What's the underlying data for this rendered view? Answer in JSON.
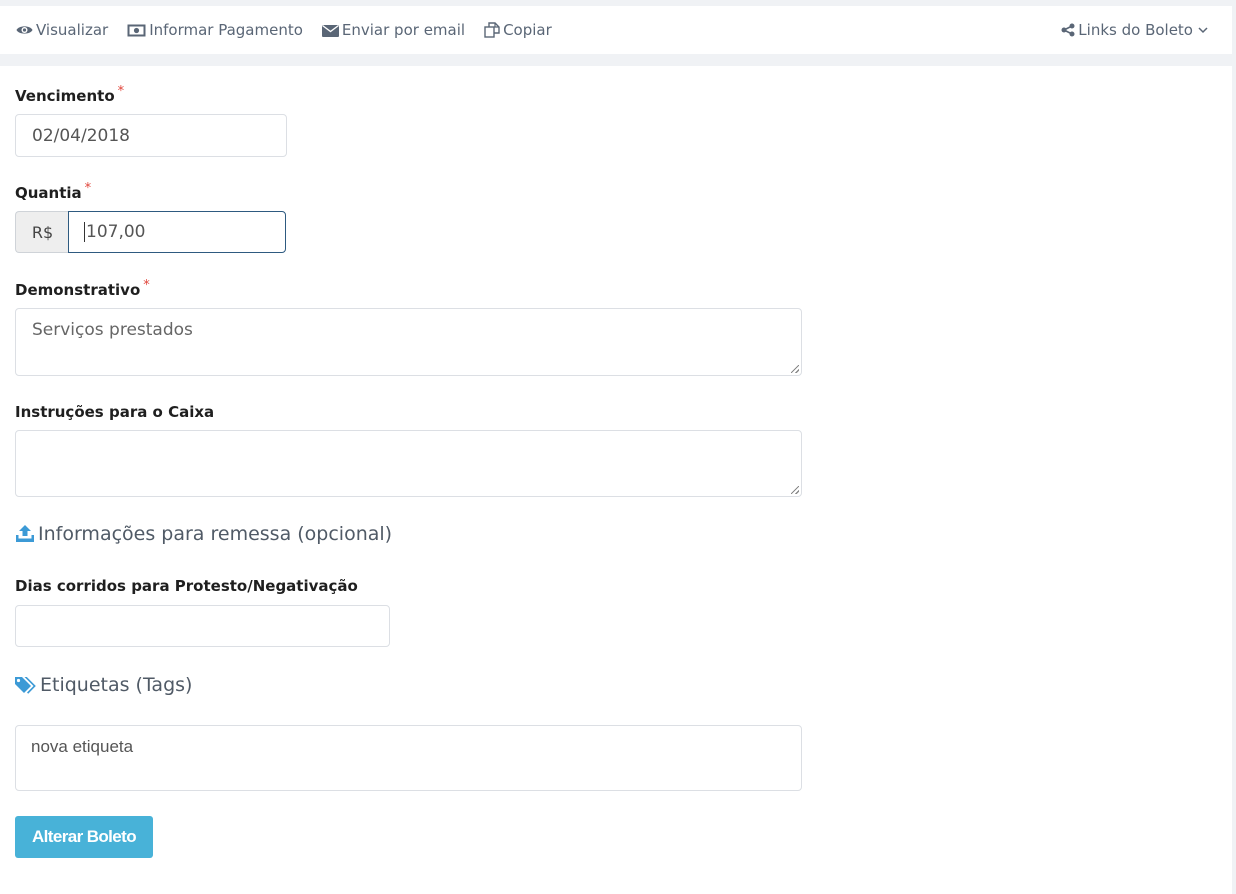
{
  "toolbar": {
    "visualizar": "Visualizar",
    "informar_pagamento": "Informar Pagamento",
    "enviar_email": "Enviar por email",
    "copiar": "Copiar",
    "links_boleto": "Links do Boleto"
  },
  "form": {
    "vencimento": {
      "label": "Vencimento",
      "required_mark": "*",
      "value": "02/04/2018"
    },
    "quantia": {
      "label": "Quantia",
      "required_mark": "*",
      "currency": "R$",
      "value": "107,00"
    },
    "demonstrativo": {
      "label": "Demonstrativo",
      "required_mark": "*",
      "value": "Serviços prestados"
    },
    "instrucoes": {
      "label": "Instruções para o Caixa",
      "value": ""
    },
    "remessa_section": "Informações para remessa (opcional)",
    "dias_protesto": {
      "label": "Dias corridos para Protesto/Negativação",
      "value": ""
    },
    "tags_section": "Etiquetas (Tags)",
    "tags_placeholder": "nova etiqueta",
    "submit": "Alterar Boleto"
  },
  "icons": {
    "visualizar": "eye-icon",
    "informar_pagamento": "money-icon",
    "enviar_email": "envelope-icon",
    "copiar": "copy-icon",
    "links_boleto": "share-icon",
    "remessa": "upload-icon",
    "tags": "tags-icon"
  },
  "colors": {
    "primary_button": "#48b2d8",
    "required_mark": "#e0443a",
    "section_icon": "#3c9ad6",
    "focus_border": "#2e5a80"
  }
}
